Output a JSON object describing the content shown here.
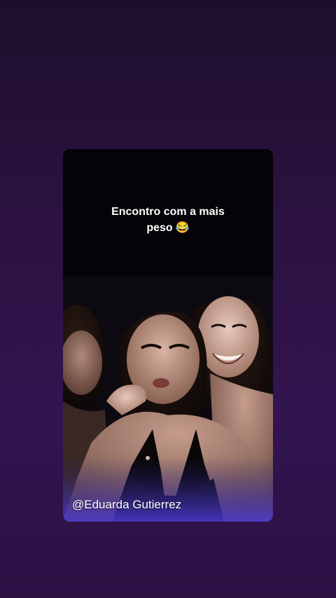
{
  "caption": {
    "line1": "Encontro com a mais",
    "line2": "peso",
    "emoji": "😂"
  },
  "watermark": "@Eduarda Gutierrez",
  "colors": {
    "background_top": "#1d0f2b",
    "background_bottom": "#331450",
    "card_background": "#050208",
    "caption_text": "#ffffff"
  }
}
